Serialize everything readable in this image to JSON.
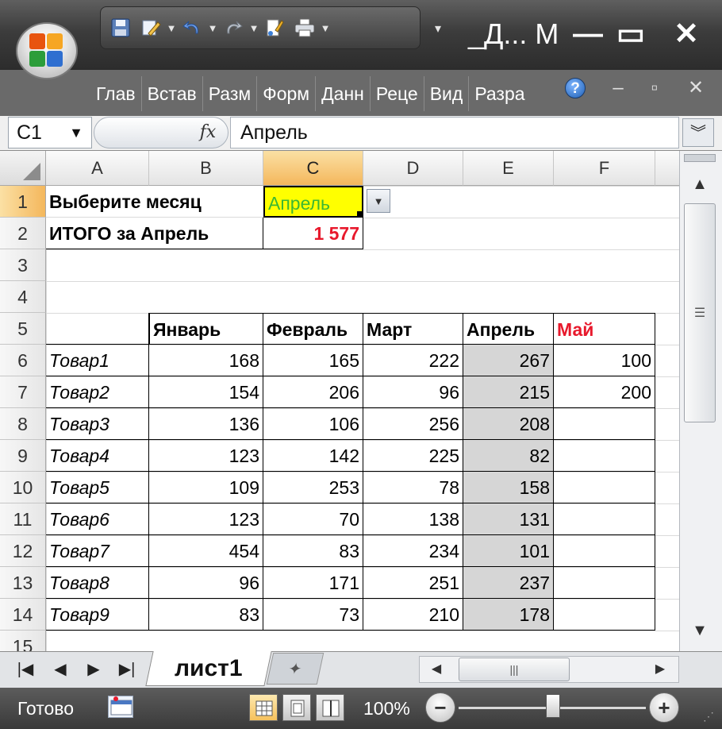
{
  "window": {
    "title": "_Д...  M",
    "minimize_glyph": "—",
    "maximize_glyph": "▭",
    "close_glyph": "✕"
  },
  "ribbon": {
    "tabs": [
      "Глав",
      "Встав",
      "Разм",
      "Форм",
      "Данн",
      "Реце",
      "Вид",
      "Разра"
    ],
    "help_glyph": "?"
  },
  "formula_bar": {
    "name_box": "C1",
    "fx_label": "fx",
    "formula": "Апрель"
  },
  "columns": [
    "A",
    "B",
    "C",
    "D",
    "E",
    "F"
  ],
  "rows": [
    "1",
    "2",
    "3",
    "4",
    "5",
    "6",
    "7",
    "8",
    "9",
    "10",
    "11",
    "12",
    "13",
    "14",
    "15"
  ],
  "sheet": {
    "a1": "Выберите месяц",
    "c1": "Апрель",
    "a2": "ИТОГО за Апрель",
    "c2": "1 577",
    "headers": [
      "Январь",
      "Февраль",
      "Март",
      "Апрель",
      "Май"
    ],
    "products": [
      {
        "name": "Товар1",
        "jan": "168",
        "feb": "165",
        "mar": "222",
        "apr": "267",
        "may": "100"
      },
      {
        "name": "Товар2",
        "jan": "154",
        "feb": "206",
        "mar": "96",
        "apr": "215",
        "may": "200"
      },
      {
        "name": "Товар3",
        "jan": "136",
        "feb": "106",
        "mar": "256",
        "apr": "208",
        "may": ""
      },
      {
        "name": "Товар4",
        "jan": "123",
        "feb": "142",
        "mar": "225",
        "apr": "82",
        "may": ""
      },
      {
        "name": "Товар5",
        "jan": "109",
        "feb": "253",
        "mar": "78",
        "apr": "158",
        "may": ""
      },
      {
        "name": "Товар6",
        "jan": "123",
        "feb": "70",
        "mar": "138",
        "apr": "131",
        "may": ""
      },
      {
        "name": "Товар7",
        "jan": "454",
        "feb": "83",
        "mar": "234",
        "apr": "101",
        "may": ""
      },
      {
        "name": "Товар8",
        "jan": "96",
        "feb": "171",
        "mar": "251",
        "apr": "237",
        "may": ""
      },
      {
        "name": "Товар9",
        "jan": "83",
        "feb": "73",
        "mar": "210",
        "apr": "178",
        "may": ""
      }
    ]
  },
  "sheet_tabs": {
    "active": "лист1"
  },
  "status": {
    "text": "Готово",
    "zoom": "100%"
  },
  "colors": {
    "selected_fill": "#ffff00",
    "selected_text": "#3cb832",
    "accent_red": "#e8192c",
    "highlight_gray": "#d6d6d6"
  }
}
